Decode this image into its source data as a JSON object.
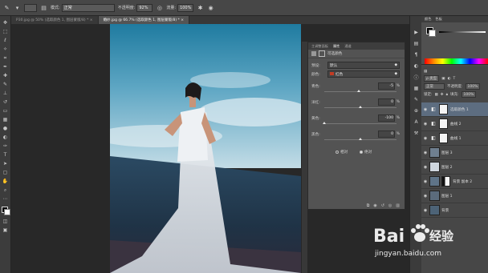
{
  "options_bar": {
    "mode_label": "模式:",
    "mode_value": "正常",
    "opacity_label": "不透明度:",
    "opacity_value": "92%",
    "flow_label": "流量:",
    "flow_value": "100%"
  },
  "document_tabs": [
    {
      "label": "P30.jpg @ 50% (选取颜色 1, 图层蒙版/8) *",
      "active": false
    },
    {
      "label": "婚纱.jpg @ 66.7% (选取颜色 1, 图层蒙版/8) *",
      "active": true
    }
  ],
  "properties_panel": {
    "tab_left": "主调整面板",
    "tab_active": "属性",
    "tab_right": "通道",
    "title": "可选颜色",
    "preset_label": "预设:",
    "preset_value": "默认",
    "colors_label": "颜色:",
    "colors_value": "红色",
    "colors_swatch": "#c23b23",
    "sliders": [
      {
        "label": "青色:",
        "value": "-5",
        "pct": "%",
        "fraction": 0.475
      },
      {
        "label": "洋红:",
        "value": "0",
        "pct": "%",
        "fraction": 0.5
      },
      {
        "label": "黄色:",
        "value": "-100",
        "pct": "%",
        "fraction": 0.0
      },
      {
        "label": "黑色:",
        "value": "0",
        "pct": "%",
        "fraction": 0.5
      }
    ],
    "method_relative": "相对",
    "method_absolute": "绝对",
    "method_selected": "absolute"
  },
  "color_panel": {
    "tab_color": "颜色",
    "tab_swatches": "色板"
  },
  "layers_panel": {
    "kind_label": "ρ 类型",
    "blend_mode": "正常",
    "opacity_label": "不透明度:",
    "opacity_value": "100%",
    "lock_label": "锁定:",
    "fill_label": "填充:",
    "fill_value": "100%",
    "layers": [
      {
        "name": "选取颜色 1",
        "type": "adjustment",
        "selected": true,
        "thumb_color": "#efefef"
      },
      {
        "name": "曲线 2",
        "type": "adjustment",
        "selected": false,
        "thumb_color": "#efefef"
      },
      {
        "name": "曲线 1",
        "type": "adjustment",
        "selected": false,
        "thumb_color": "#efefef"
      },
      {
        "name": "图层 3",
        "type": "image",
        "selected": false,
        "thumb_color": "#6f7f8f"
      },
      {
        "name": "图层 2",
        "type": "image",
        "selected": false,
        "thumb_color": "#cfd6de"
      },
      {
        "name": "背景 副本 2",
        "type": "masked",
        "selected": false,
        "thumb_color": "#5f7488"
      },
      {
        "name": "图层 1",
        "type": "image",
        "selected": false,
        "thumb_color": "#5b6b7c"
      },
      {
        "name": "背景",
        "type": "image",
        "selected": false,
        "thumb_color": "#4d6377"
      }
    ]
  },
  "watermark": {
    "brand": "Bai",
    "brand_tail": "经验",
    "url": "jingyan.baidu.com"
  }
}
